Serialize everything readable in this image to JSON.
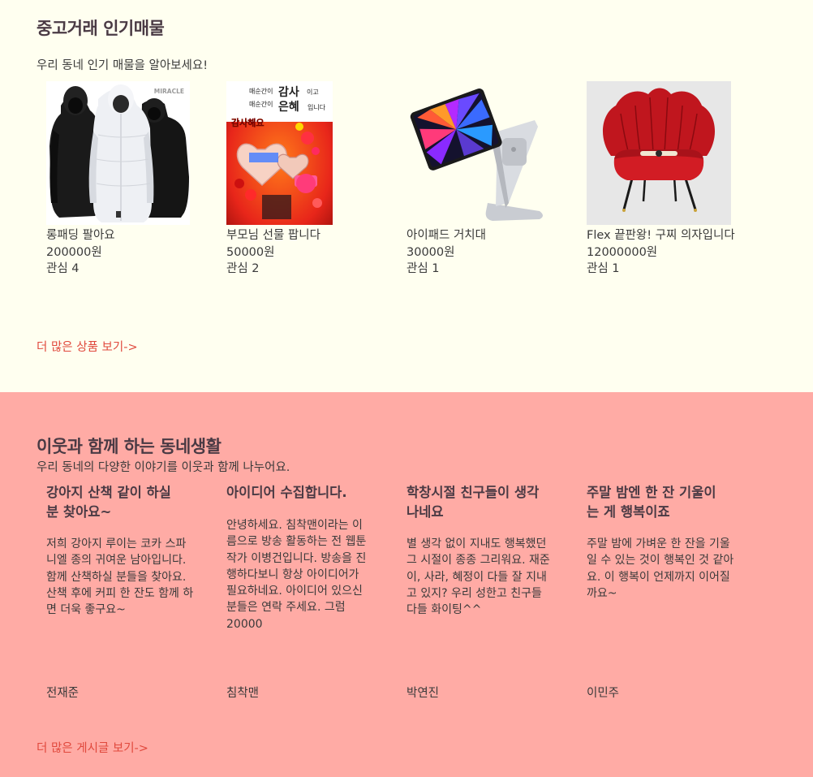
{
  "market": {
    "title": "중고거래 인기매물",
    "subtitle": "우리 동네 인기 매물을 알아보세요!",
    "items": [
      {
        "name": "롱패딩 팔아요",
        "price": "200000원",
        "likes": "관심 4",
        "image": "padding-coats-photo",
        "brand_mark": "MIRACLE"
      },
      {
        "name": "부모님 선물 팝니다",
        "price": "50000원",
        "likes": "관심 2",
        "image": "money-gift-board-photo",
        "poster": {
          "line1a": "매순간이",
          "line1b": "감사",
          "line1c": "이고",
          "line2a": "매순간이",
          "line2b": "은혜",
          "line2c": "입니다",
          "line3": "감사해요"
        }
      },
      {
        "name": "아이패드 거치대",
        "price": "30000원",
        "likes": "관심 1",
        "image": "ipad-stand-photo"
      },
      {
        "name": "Flex 끝판왕! 구찌 의자입니다",
        "price": "12000000원",
        "likes": "관심 1",
        "image": "red-chair-photo"
      }
    ],
    "more_link": "더 많은 상품 보기->"
  },
  "community": {
    "title": "이웃과 함께 하는 동네생활",
    "subtitle": "우리 동네의 다양한 이야기를 이웃과 함께 나누어요.",
    "posts": [
      {
        "title_lines": [
          "강아지 산책 같이 하실",
          "분 찾아요~"
        ],
        "body_lines": [
          "저희 강아지 루이는 코카 스파",
          "니엘 종의 귀여운 남아입니다.",
          "함께 산책하실 분들을 찾아요.",
          "산책 후에 커피 한 잔도 함께 하",
          "면 더욱 좋구요~"
        ],
        "author": "전재준"
      },
      {
        "title_lines": [
          "아이디어 수집합니다."
        ],
        "body_lines": [
          "안녕하세요. 침착맨이라는 이",
          "름으로 방송 활동하는 전 웹툰",
          "작가 이병건입니다. 방송을 진",
          "행하다보니 항상 아이디어가",
          "필요하네요. 아이디어 있으신",
          "분들은 연락 주세요. 그럼",
          "20000"
        ],
        "author": "침착맨"
      },
      {
        "title_lines": [
          "학창시절 친구들이 생각",
          "나네요"
        ],
        "body_lines": [
          "별 생각 없이 지내도 행복했던",
          "그 시절이 종종 그리워요. 재준",
          "이, 사라, 혜정이 다들 잘 지내",
          "고 있지? 우리 성한고 친구들",
          "다들 화이팅^^"
        ],
        "author": "박연진"
      },
      {
        "title_lines": [
          "주말 밤엔 한 잔 기울이",
          "는 게 행복이죠"
        ],
        "body_lines": [
          "주말 밤에 가벼운 한 잔을 기울",
          "일 수 있는 것이 행복인 것 같아",
          "요. 이 행복이 언제까지 이어질",
          "까요~"
        ],
        "author": "이민주"
      }
    ],
    "more_link": "더 많은 게시글 보기->"
  },
  "colors": {
    "cream_bg": "#fffff0",
    "pink_bg": "#ffaba5",
    "link": "#e0483c",
    "heading": "#4a3a44"
  }
}
